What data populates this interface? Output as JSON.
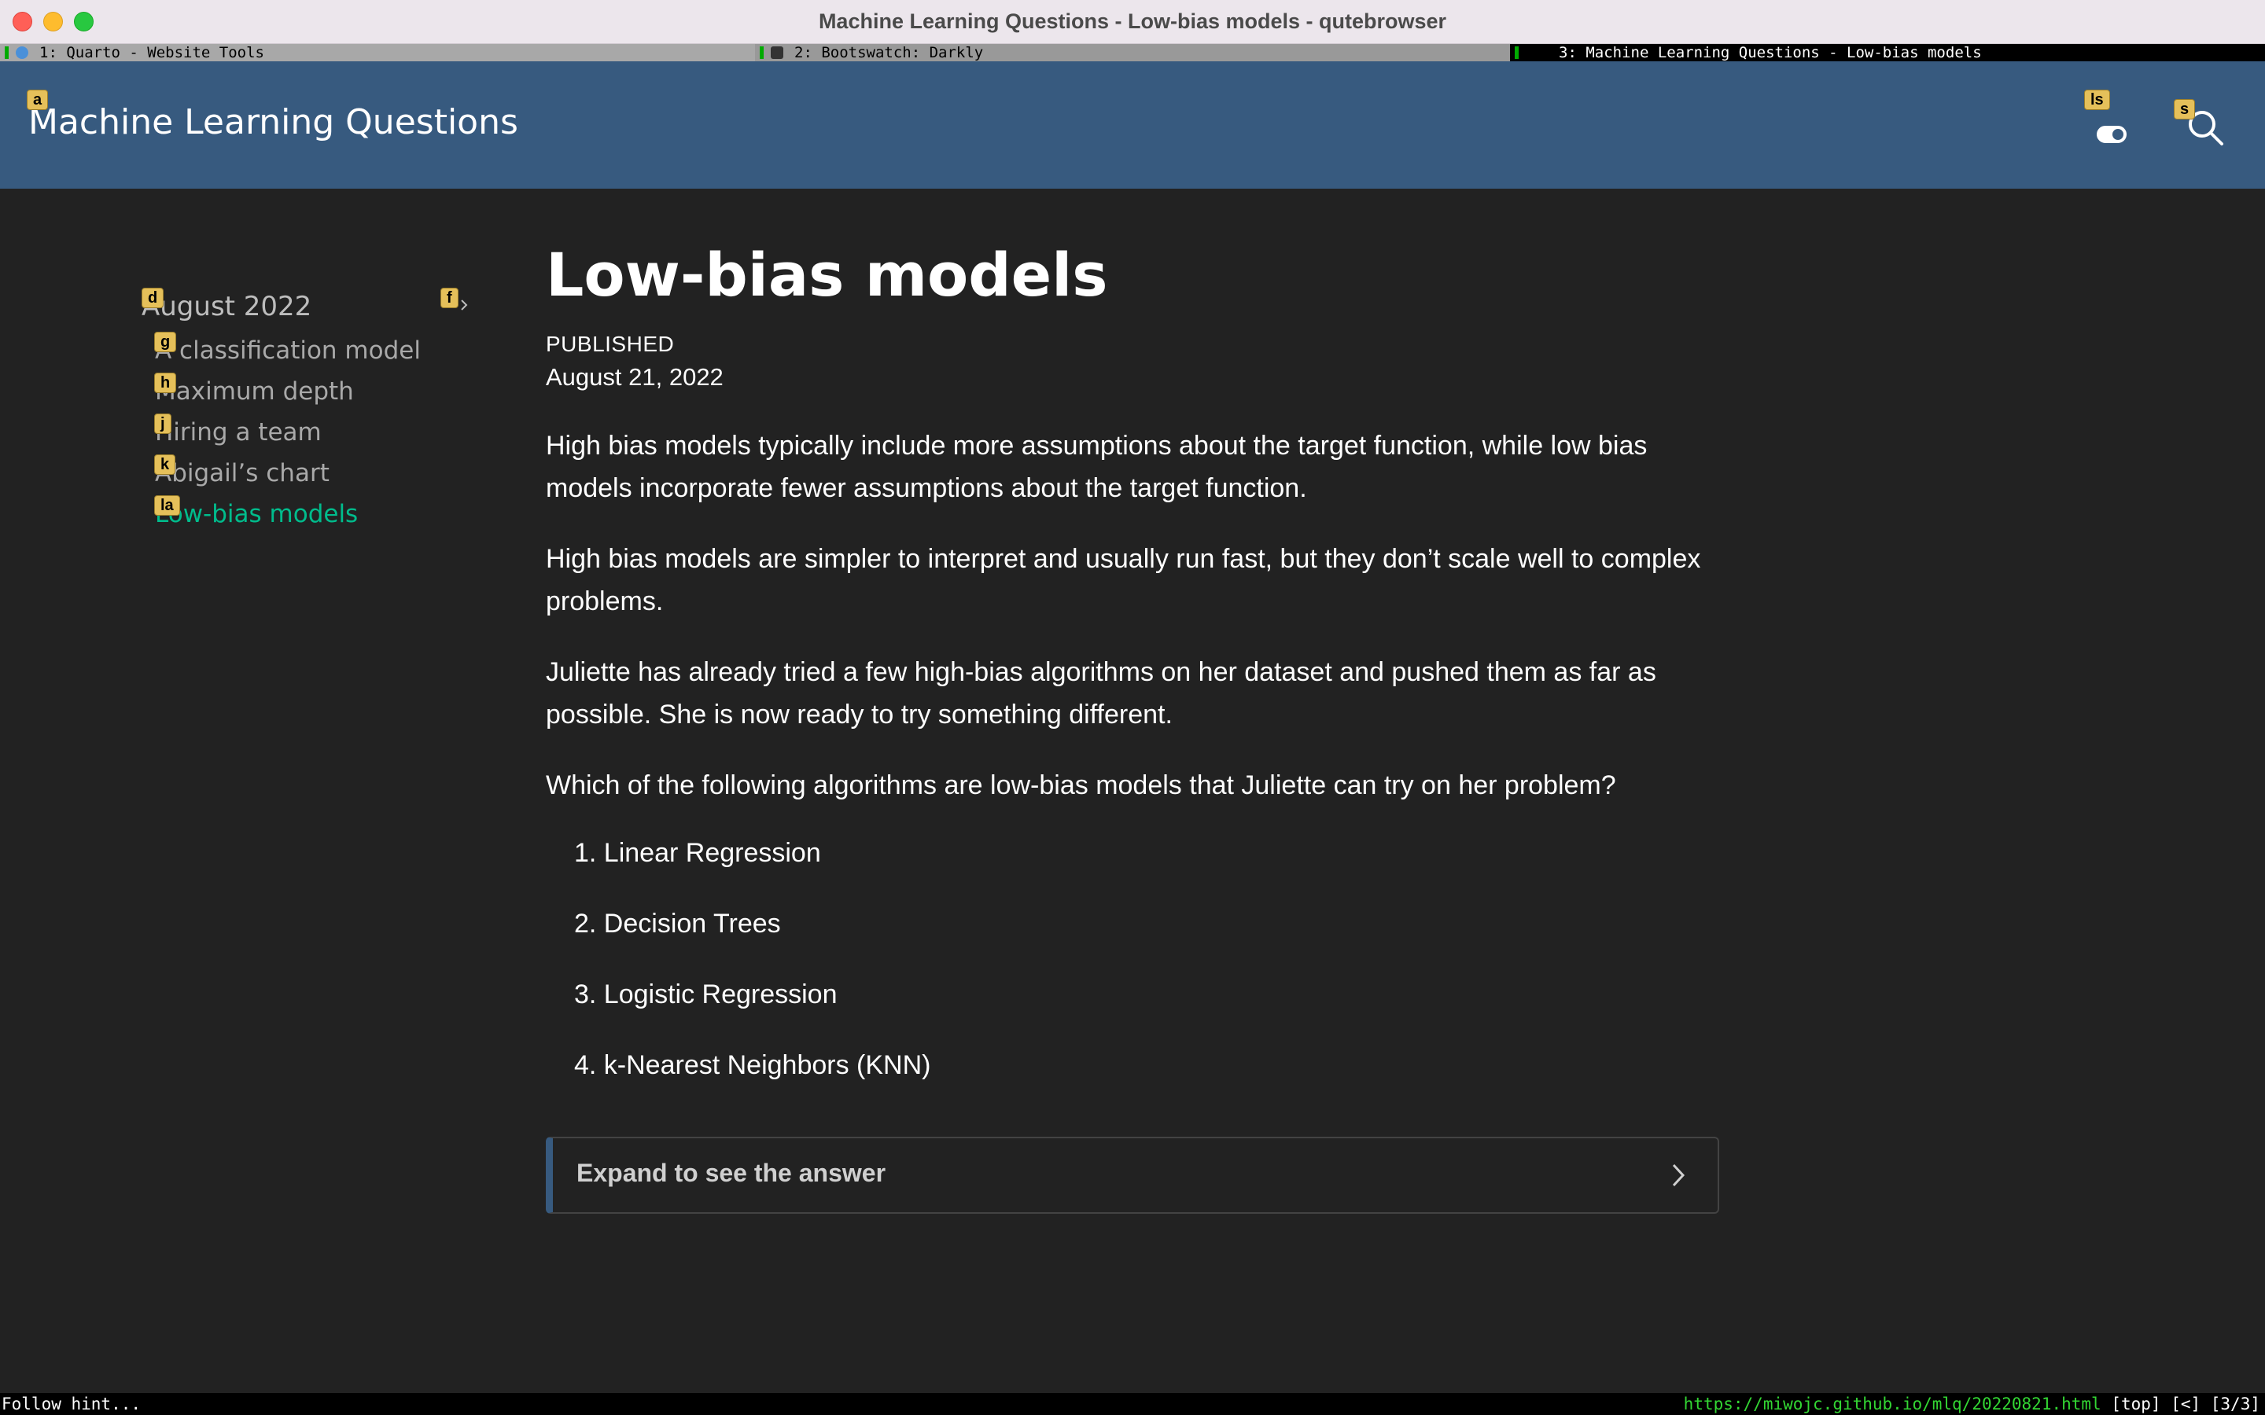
{
  "window": {
    "title": "Machine Learning Questions - Low-bias models - qutebrowser"
  },
  "tabs": [
    {
      "label": "1: Quarto - Website Tools"
    },
    {
      "label": "2: Bootswatch: Darkly"
    },
    {
      "label": "3: Machine Learning Questions - Low-bias models"
    }
  ],
  "navbar": {
    "brand": "Machine Learning Questions",
    "toggle_icon": "toggle-switch-icon",
    "search_icon": "search-icon"
  },
  "hints": {
    "brand": "a",
    "toggle": "ls",
    "search": "s",
    "section": "d",
    "section_toggle": "f",
    "item1": "g",
    "item2": "h",
    "item3": "j",
    "item4": "k",
    "item5": "la"
  },
  "sidebar": {
    "section": "August 2022",
    "items": [
      {
        "label": "A classification model"
      },
      {
        "label": "Maximum depth"
      },
      {
        "label": "Hiring a team"
      },
      {
        "label": "Abigail’s chart"
      },
      {
        "label": "Low-bias models"
      }
    ]
  },
  "article": {
    "title": "Low-bias models",
    "published_label": "PUBLISHED",
    "published_date": "August 21, 2022",
    "paragraphs": [
      "High bias models typically include more assumptions about the target function, while low bias models incorporate fewer assumptions about the target function.",
      "High bias models are simpler to interpret and usually run fast, but they don’t scale well to complex problems.",
      "Juliette has already tried a few high-bias algorithms on her dataset and pushed them as far as possible. She is now ready to try something different.",
      "Which of the following algorithms are low-bias models that Juliette can try on her problem?"
    ],
    "options": [
      "1. Linear Regression",
      "2. Decision Trees",
      "3. Logistic Regression",
      "4. k-Nearest Neighbors (KNN)"
    ],
    "callout": "Expand to see the answer"
  },
  "statusbar": {
    "left": "Follow hint...",
    "url": "https://miwojc.github.io/mlq/20220821.html",
    "right": "[top] [<] [3/3]"
  },
  "colors": {
    "navbar": "#375a7f",
    "background": "#222222",
    "accent": "#00bc8c",
    "hint": "#e5c05a"
  }
}
